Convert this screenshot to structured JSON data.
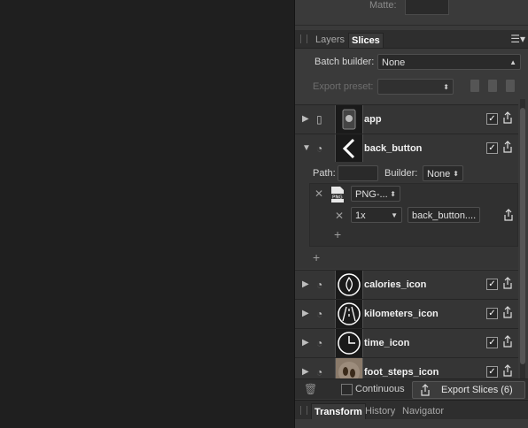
{
  "top": {
    "matte_label": "Matte:"
  },
  "tabs": [
    {
      "label": "Layers"
    },
    {
      "label": "Slices"
    }
  ],
  "batch_builder": {
    "label": "Batch builder:",
    "value": "None"
  },
  "export_preset": {
    "label": "Export preset:",
    "value": ""
  },
  "slices": [
    {
      "name": "app",
      "icon": "document-icon"
    },
    {
      "name": "back_button",
      "icon": "slice-group-icon"
    },
    {
      "name": "calories_icon",
      "icon": "slice-group-icon"
    },
    {
      "name": "kilometers_icon",
      "icon": "slice-group-icon"
    },
    {
      "name": "time_icon",
      "icon": "slice-group-icon"
    },
    {
      "name": "foot_steps_icon",
      "icon": "slice-group-icon"
    }
  ],
  "detail": {
    "path_label": "Path:",
    "builder_label": "Builder:",
    "builder_value": "None",
    "format_value": "PNG-...",
    "format_badge": "PNG",
    "scale_value": "1x",
    "filename_value": "back_button...."
  },
  "bottom": {
    "continuous_label": "Continuous",
    "export_label": "Export Slices (6)"
  },
  "bottom_tabs": [
    {
      "label": "Transform"
    },
    {
      "label": "History"
    },
    {
      "label": "Navigator"
    }
  ]
}
